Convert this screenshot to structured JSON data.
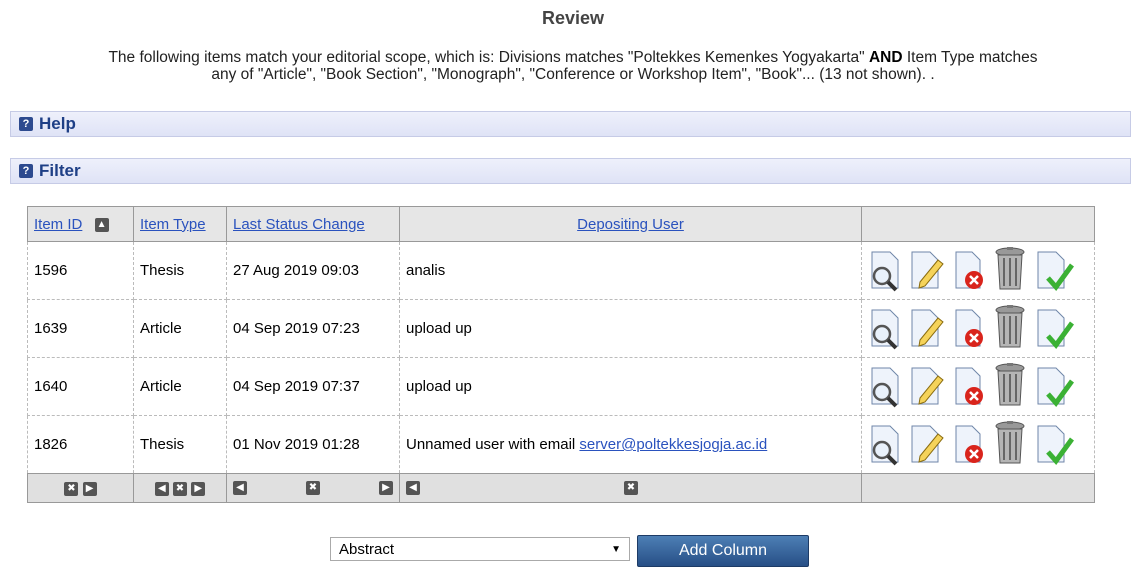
{
  "page": {
    "title": "Review",
    "scope_line1_a": "The following items match your editorial scope, which is: Divisions matches \"Poltekkes Kemenkes Yogyakarta\" ",
    "scope_and": "AND",
    "scope_line1_b": " Item Type matches",
    "scope_line2": "any of \"Article\", \"Book Section\", \"Monograph\", \"Conference or Workshop Item\", \"Book\"... (13 not shown). ."
  },
  "sections": {
    "help": "Help",
    "filter": "Filter"
  },
  "table": {
    "headers": {
      "item_id": "Item ID",
      "item_type": "Item Type",
      "last_status_change": "Last Status Change",
      "depositing_user": "Depositing User"
    },
    "rows": [
      {
        "id": "1596",
        "type": "Thesis",
        "changed": "27 Aug 2019 09:03",
        "user": "analis",
        "email": ""
      },
      {
        "id": "1639",
        "type": "Article",
        "changed": "04 Sep 2019 07:23",
        "user": "upload up",
        "email": ""
      },
      {
        "id": "1640",
        "type": "Article",
        "changed": "04 Sep 2019 07:37",
        "user": "upload up",
        "email": ""
      },
      {
        "id": "1826",
        "type": "Thesis",
        "changed": "01 Nov 2019 01:28",
        "user": "Unnamed user with email ",
        "email": "server@poltekkesjogja.ac.id"
      }
    ],
    "action_icons": [
      "view-icon",
      "edit-icon",
      "reject-icon",
      "delete-icon",
      "accept-icon"
    ]
  },
  "column_select": {
    "value": "Abstract"
  },
  "add_column_label": "Add Column"
}
